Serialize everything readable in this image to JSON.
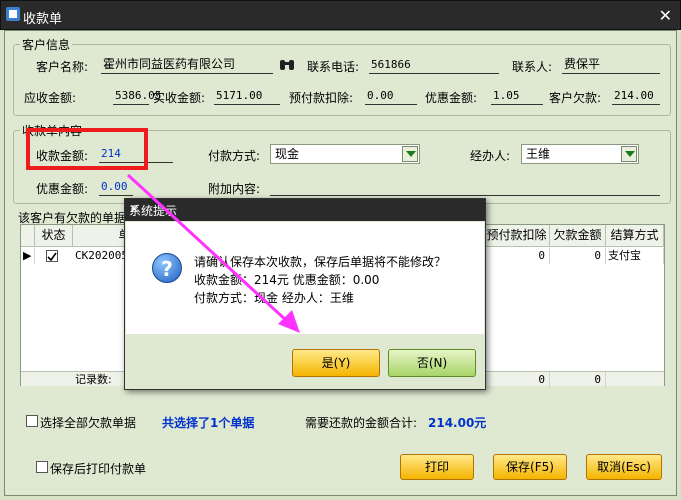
{
  "window": {
    "title": "收款单",
    "close_label": "✕"
  },
  "customer": {
    "group_title": "客户信息",
    "name_label": "客户名称:",
    "name_value": "霍州市同益医药有限公司",
    "phone_label": "联系电话:",
    "phone_value": "561866",
    "contact_label": "联系人:",
    "contact_value": "费保平",
    "receivable_label": "应收金额:",
    "receivable_value": "5386.05",
    "received_label": "实收金额:",
    "received_value": "5171.00",
    "prepaid_label": "预付款扣除:",
    "prepaid_value": "0.00",
    "discount_label": "优惠金额:",
    "discount_value": "1.05",
    "owed_label": "客户欠款:",
    "owed_value": "214.00"
  },
  "payment": {
    "group_title": "收款单内容",
    "amount_label": "收款金额:",
    "amount_value": "214",
    "method_label": "付款方式:",
    "method_value": "现金",
    "handler_label": "经办人:",
    "handler_value": "王维",
    "discount_label": "优惠金额:",
    "discount_value": "0.00",
    "extra_label": "附加内容:",
    "extra_value": ""
  },
  "debts": {
    "title": "该客户有欠款的单据",
    "columns": [
      "状态",
      "单",
      "预付款扣除",
      "欠款金额",
      "结算方式"
    ],
    "row": {
      "doc": "CK202005",
      "prepaid": "0",
      "owed": "0",
      "method": "支付宝"
    },
    "footer": {
      "count_label": "记录数:",
      "prepaid": "0",
      "owed": "0"
    }
  },
  "bottom": {
    "select_all_label": "选择全部欠款单据",
    "selected_text": "共选择了1个单据",
    "total_label": "需要还款的金额合计:",
    "total_value": "214.00元",
    "print_after_label": "保存后打印付款单",
    "print_button": "打印",
    "save_button": "保存(F5)",
    "cancel_button": "取消(Esc)"
  },
  "dialog": {
    "title": "系统提示",
    "close_label": "✕",
    "line1": "请确认保存本次收款，保存后单据将不能修改？",
    "line2": "收款金额：214元    优惠金额：0.00",
    "line3": "付款方式：现金    经办人：王维",
    "yes_button": "是(Y)",
    "no_button": "否(N)"
  },
  "colors": {
    "highlight_box": "#ee1c1c",
    "arrow": "#ff33ff",
    "accent_blue": "#0033cc"
  }
}
